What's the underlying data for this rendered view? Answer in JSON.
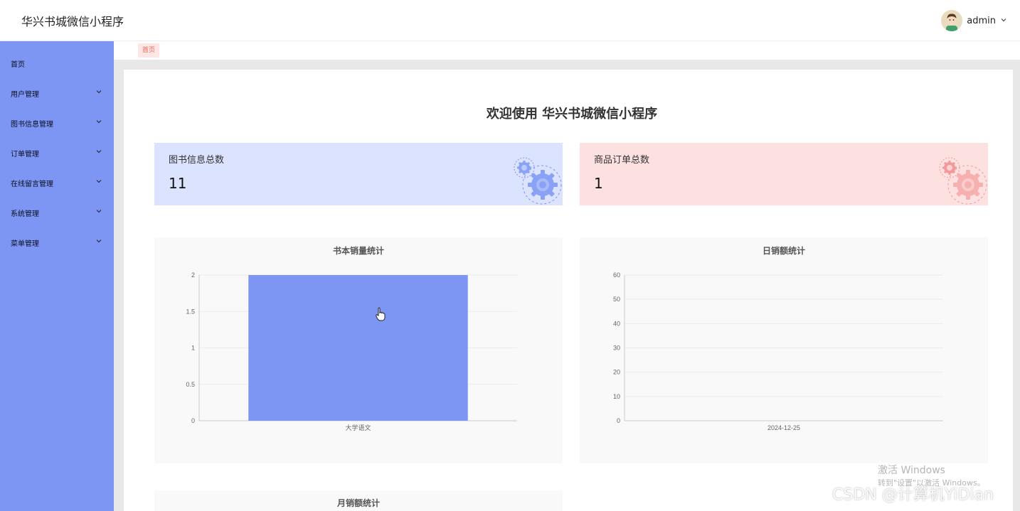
{
  "header": {
    "app_title": "华兴书城微信小程序",
    "user_name": "admin"
  },
  "sidebar": {
    "items": [
      {
        "label": "首页",
        "has_children": false
      },
      {
        "label": "用户管理",
        "has_children": true
      },
      {
        "label": "图书信息管理",
        "has_children": true
      },
      {
        "label": "订单管理",
        "has_children": true
      },
      {
        "label": "在线留言管理",
        "has_children": true
      },
      {
        "label": "系统管理",
        "has_children": true
      },
      {
        "label": "菜单管理",
        "has_children": true
      }
    ]
  },
  "breadcrumb": {
    "tag": "首页"
  },
  "welcome": "欢迎使用 华兴书城微信小程序",
  "stats": [
    {
      "label": "图书信息总数",
      "value": "11",
      "color": "#dbe3fe",
      "gear_color": "#7d96f3"
    },
    {
      "label": "商品订单总数",
      "value": "1",
      "color": "#fde1e1",
      "gear_color": "#f4a1a1"
    }
  ],
  "chart_data": [
    {
      "type": "bar",
      "title": "书本销量统计",
      "categories": [
        "大学语文"
      ],
      "values": [
        2
      ],
      "ylim": [
        0,
        2
      ],
      "yticks": [
        "0",
        "0.5",
        "1",
        "1.5",
        "2"
      ],
      "ytick_values": [
        0,
        0.5,
        1,
        1.5,
        2
      ],
      "bar_color": "#7d96f3",
      "grid": true
    },
    {
      "type": "bar",
      "title": "日销额统计",
      "categories": [
        "2024-12-25"
      ],
      "values": [
        0
      ],
      "ylim": [
        0,
        60
      ],
      "yticks": [
        "0",
        "10",
        "20",
        "30",
        "40",
        "50",
        "60"
      ],
      "ytick_values": [
        0,
        10,
        20,
        30,
        40,
        50,
        60
      ],
      "bar_color": "#7d96f3",
      "grid": true
    },
    {
      "type": "bar",
      "title": "月销额统计"
    }
  ],
  "watermark": {
    "line1": "激活 Windows",
    "line2": "转到\"设置\"以激活 Windows。",
    "csdn": "CSDN @计算机YiDian"
  }
}
